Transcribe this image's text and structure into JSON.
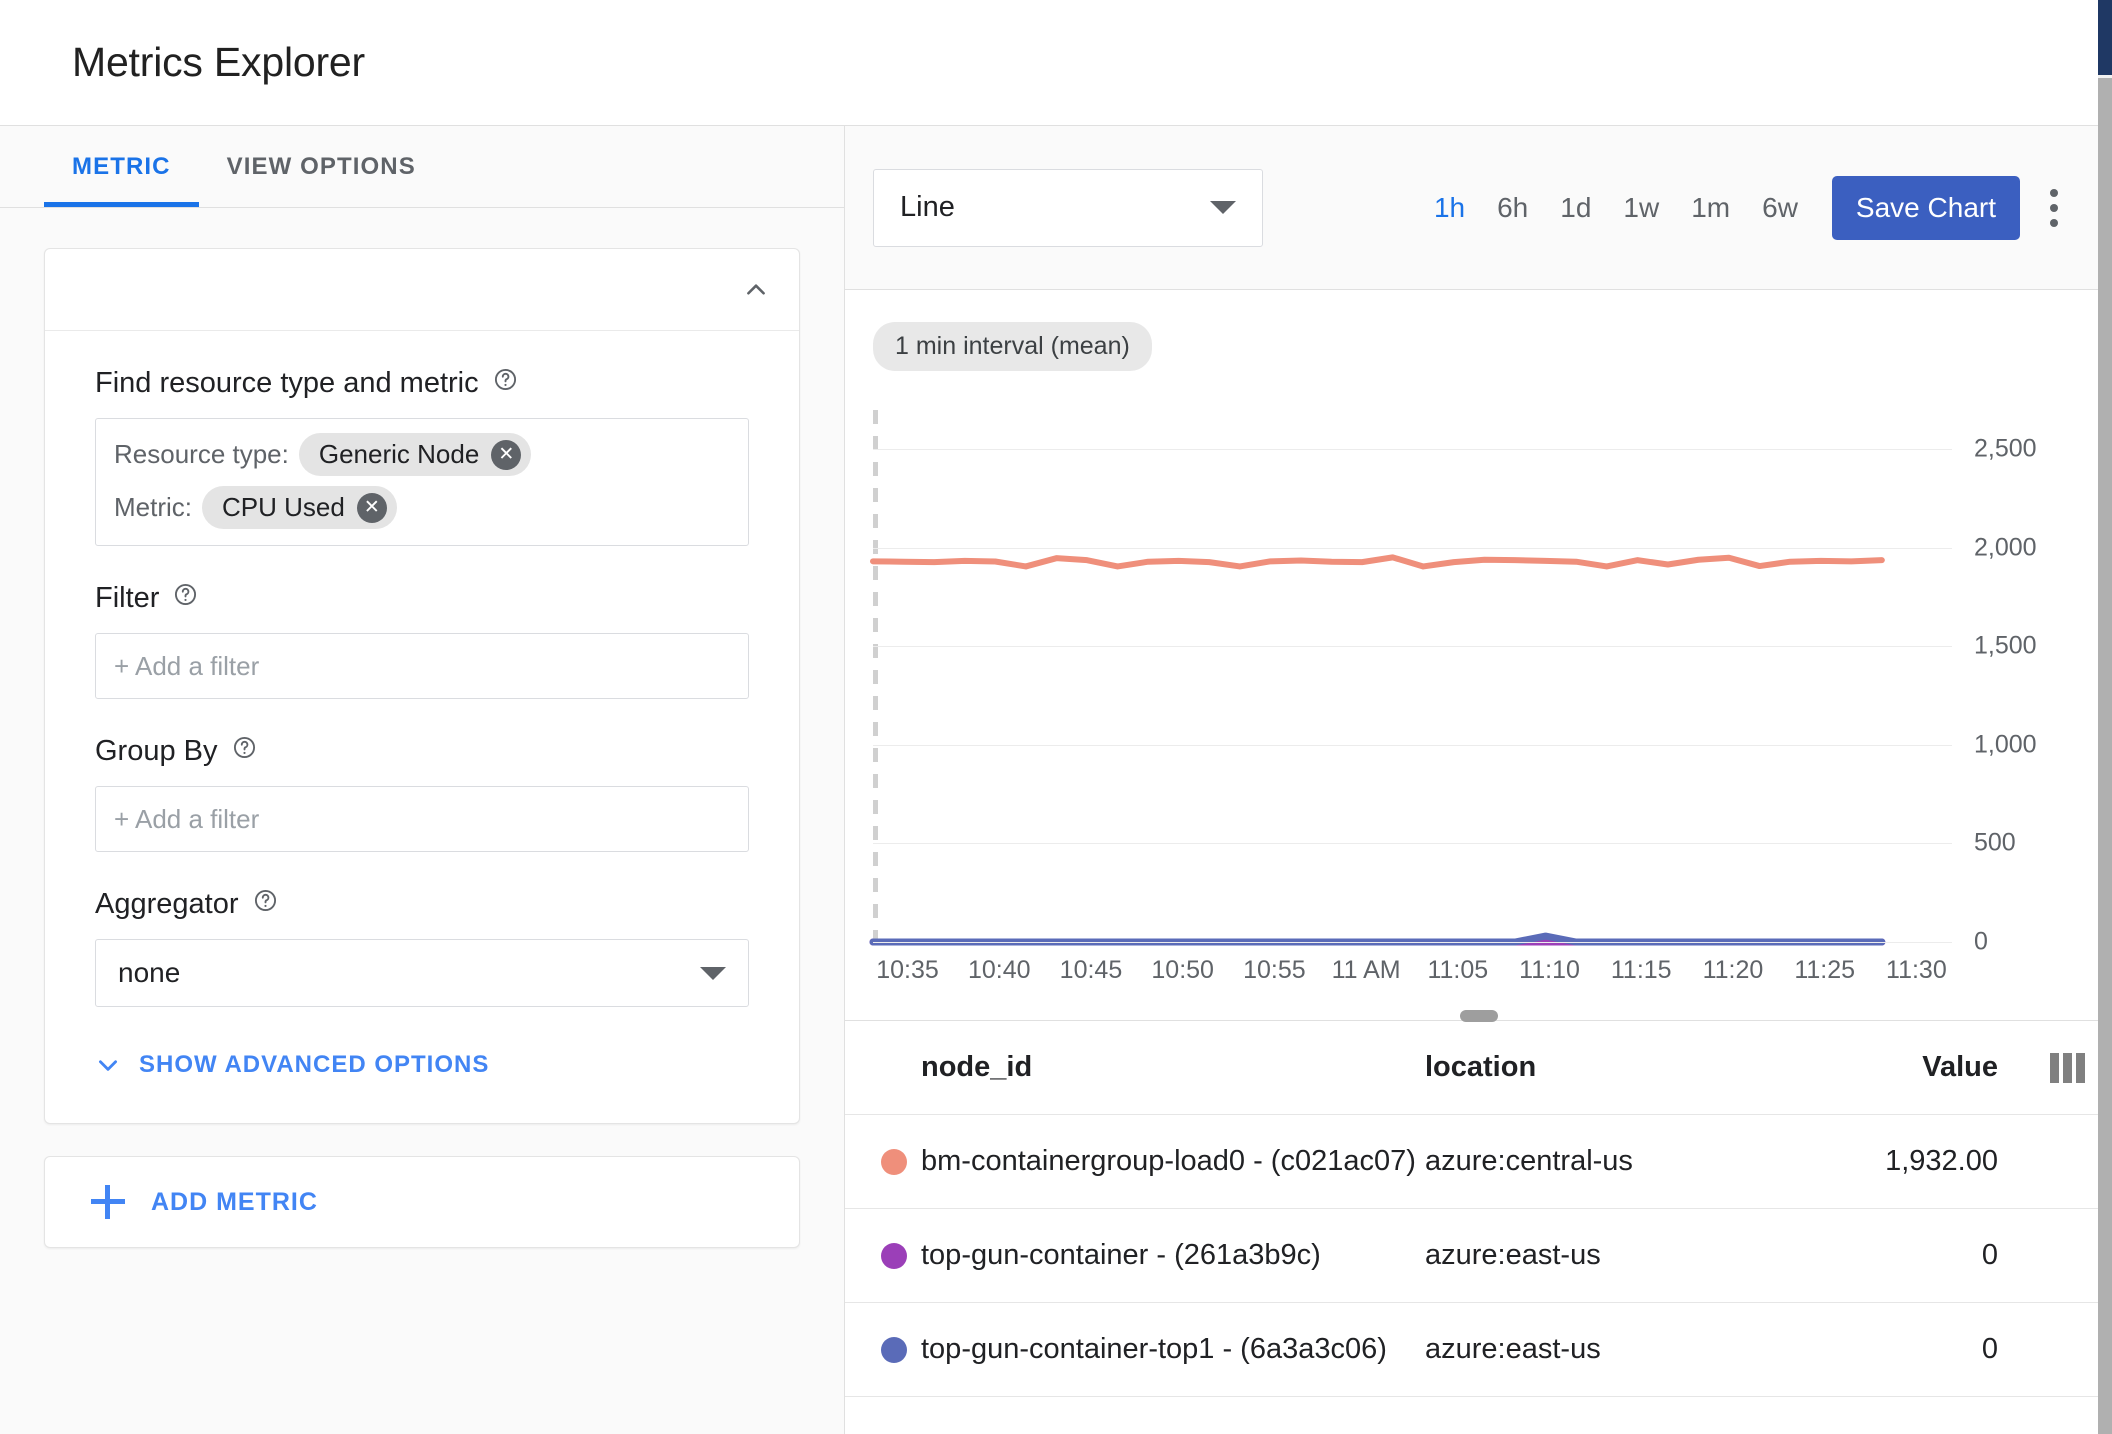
{
  "header": {
    "title": "Metrics Explorer"
  },
  "tabs": [
    {
      "label": "METRIC",
      "active": true
    },
    {
      "label": "VIEW OPTIONS",
      "active": false
    }
  ],
  "metric_card": {
    "collapse_icon": "chevron-up-icon",
    "find_label": "Find resource type and metric",
    "resource_type_key": "Resource type:",
    "resource_type_value": "Generic Node",
    "metric_key": "Metric:",
    "metric_value": "CPU Used",
    "filter_label": "Filter",
    "filter_placeholder": "+ Add a filter",
    "group_by_label": "Group By",
    "group_by_placeholder": "+ Add a filter",
    "aggregator_label": "Aggregator",
    "aggregator_value": "none",
    "advanced_link": "SHOW ADVANCED OPTIONS",
    "add_metric": "ADD METRIC"
  },
  "toolbar": {
    "chart_type": "Line",
    "ranges": [
      "1h",
      "6h",
      "1d",
      "1w",
      "1m",
      "6w"
    ],
    "active_range": "1h",
    "save_label": "Save Chart",
    "menu_icon": "kebab-menu-icon"
  },
  "chart": {
    "interval_badge": "1 min interval (mean)"
  },
  "table": {
    "columns": [
      "node_id",
      "location",
      "Value"
    ],
    "rows": [
      {
        "color": "#ef8f7b",
        "node_id": "bm-containergroup-load0 - (c021ac07)",
        "location": "azure:central-us",
        "value": "1,932.00"
      },
      {
        "color": "#9b3fb8",
        "node_id": "top-gun-container - (261a3b9c)",
        "location": "azure:east-us",
        "value": "0"
      },
      {
        "color": "#5a6bb8",
        "node_id": "top-gun-container-top1 - (6a3a3c06)",
        "location": "azure:east-us",
        "value": "0"
      }
    ]
  },
  "colors": {
    "accent": "#1a73e8",
    "save_button": "#3b5fc0",
    "series_1": "#ef8f7b",
    "series_2": "#9b3fb8",
    "series_3": "#5a6bb8"
  },
  "chart_data": {
    "type": "line",
    "title": "",
    "xlabel": "",
    "ylabel": "",
    "ylim": [
      0,
      2700
    ],
    "yticks": [
      0,
      500,
      1000,
      1500,
      2000,
      2500
    ],
    "ytick_labels": [
      "0",
      "500",
      "1,000",
      "1,500",
      "2,000",
      "2,500"
    ],
    "grid": true,
    "legend_position": "table-below",
    "x": [
      "10:35",
      "10:40",
      "10:45",
      "10:50",
      "10:55",
      "11 AM",
      "11:05",
      "11:10",
      "11:15",
      "11:20",
      "11:25",
      "11:30"
    ],
    "xticks": [
      "10:35",
      "10:40",
      "10:45",
      "10:50",
      "10:55",
      "11 AM",
      "11:05",
      "11:10",
      "11:15",
      "11:20",
      "11:25",
      "11:30"
    ],
    "series": [
      {
        "name": "bm-containergroup-load0 - (c021ac07)",
        "color": "#ef8f7b",
        "values": [
          1932,
          1930,
          1928,
          1934,
          1931,
          1906,
          1948,
          1938,
          1906,
          1930,
          1934,
          1928,
          1906,
          1932,
          1936,
          1930,
          1928,
          1952,
          1906,
          1928,
          1940,
          1938,
          1934,
          1930,
          1906,
          1938,
          1916,
          1940,
          1950,
          1908,
          1930,
          1934,
          1932,
          1938
        ]
      },
      {
        "name": "top-gun-container - (261a3b9c)",
        "color": "#9b3fb8",
        "values": [
          0,
          0,
          0,
          0,
          0,
          0,
          0,
          0,
          0,
          0,
          0,
          0,
          0,
          0,
          0,
          0,
          0,
          0,
          0,
          0,
          0,
          0,
          0,
          0,
          0,
          0,
          0,
          0,
          0,
          0,
          0,
          0,
          0,
          0
        ]
      },
      {
        "name": "top-gun-container-top1 - (6a3a3c06)",
        "color": "#5a6bb8",
        "values": [
          0,
          0,
          0,
          0,
          0,
          0,
          0,
          0,
          0,
          0,
          0,
          0,
          0,
          0,
          0,
          0,
          0,
          0,
          0,
          0,
          0,
          0,
          30,
          0,
          0,
          0,
          0,
          0,
          0,
          0,
          0,
          0,
          0,
          0
        ]
      }
    ]
  }
}
